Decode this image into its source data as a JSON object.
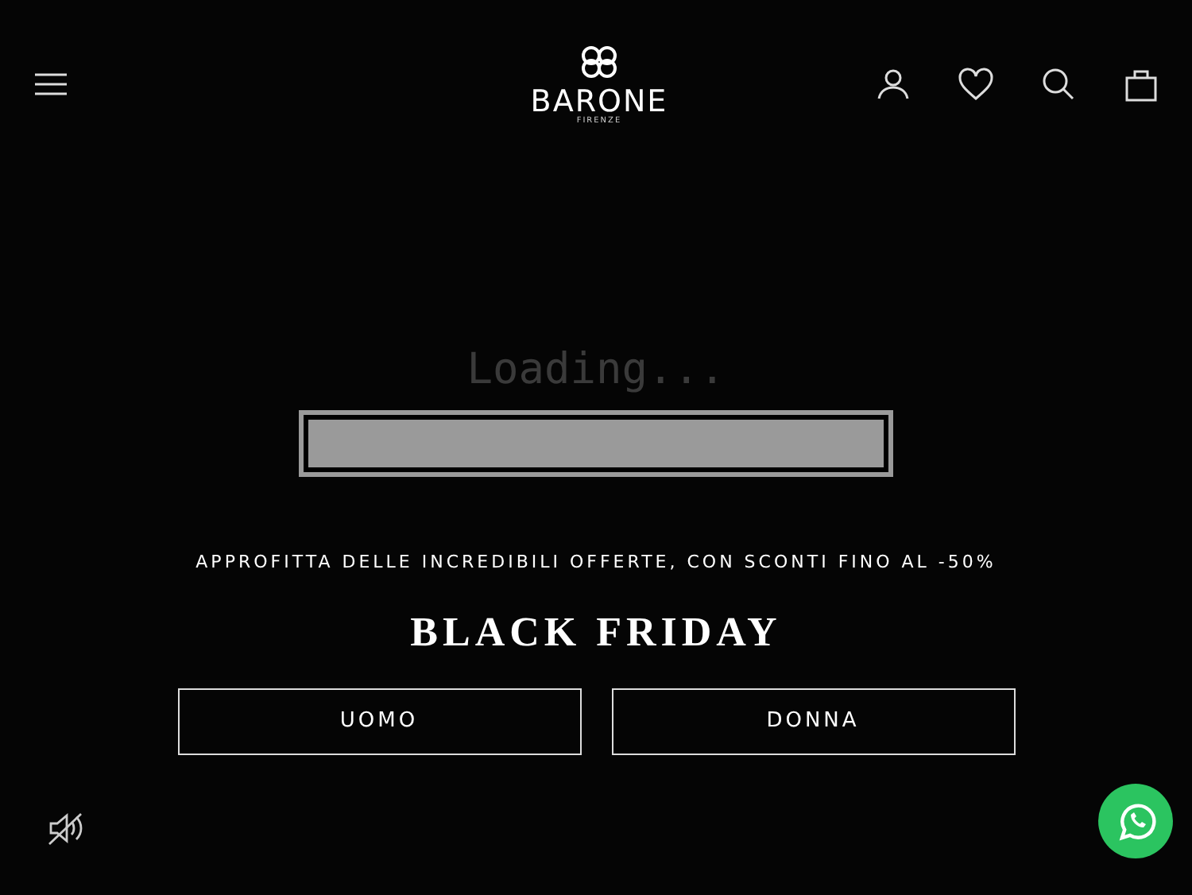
{
  "header": {
    "logo": {
      "name": "BARONE",
      "subtitle": "FIRENZE"
    }
  },
  "loader": {
    "text": "Loading...",
    "level": 1
  },
  "hero": {
    "eyebrow": "APPROFITTA DELLE INCREDIBILI OFFERTE, CON SCONTI FINO AL -50%",
    "title": "BLACK FRIDAY",
    "buttons": [
      "UOMO",
      "DONNA"
    ]
  },
  "video": {
    "muted": true
  }
}
